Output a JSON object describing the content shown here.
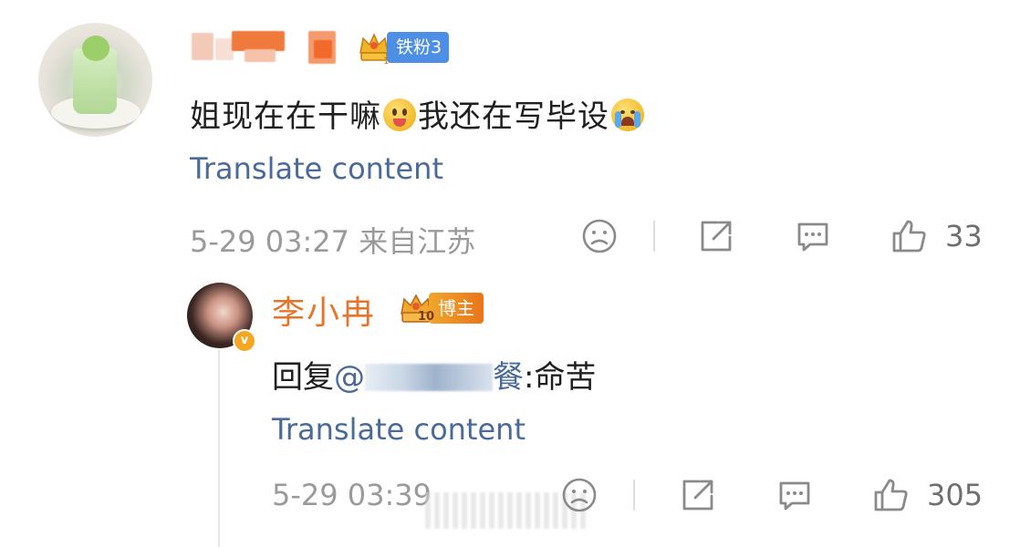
{
  "comment": {
    "username_redacted": true,
    "fan_badge": {
      "label": "铁粉3"
    },
    "text_parts": [
      "姐现在在干嘛",
      "我还在写毕设"
    ],
    "emojis": [
      "tongue-out-emoji",
      "crying-emoji"
    ],
    "translate_label": "Translate content",
    "timestamp": "5-29 03:27",
    "location": "来自江苏",
    "like_count": "33"
  },
  "reply": {
    "author_name": "李小冉",
    "verified_badge": "v",
    "blogger_badge": {
      "label": "博主",
      "level": "10"
    },
    "reply_prefix": "回复",
    "mention_prefix": "@",
    "mention_tail_visible": "餐",
    "reply_body": ":命苦",
    "translate_label": "Translate content",
    "timestamp": "5-29 03:39",
    "like_count": "305"
  },
  "colors": {
    "author_orange": "#e8742a",
    "link_blue": "#4a6a9a",
    "fan_badge_blue": "#4e8fe6",
    "meta_gray": "#9a9a9a"
  },
  "icons": [
    "sad-face-icon",
    "share-icon",
    "comment-icon",
    "like-icon",
    "crown-icon",
    "verified-v-icon"
  ]
}
